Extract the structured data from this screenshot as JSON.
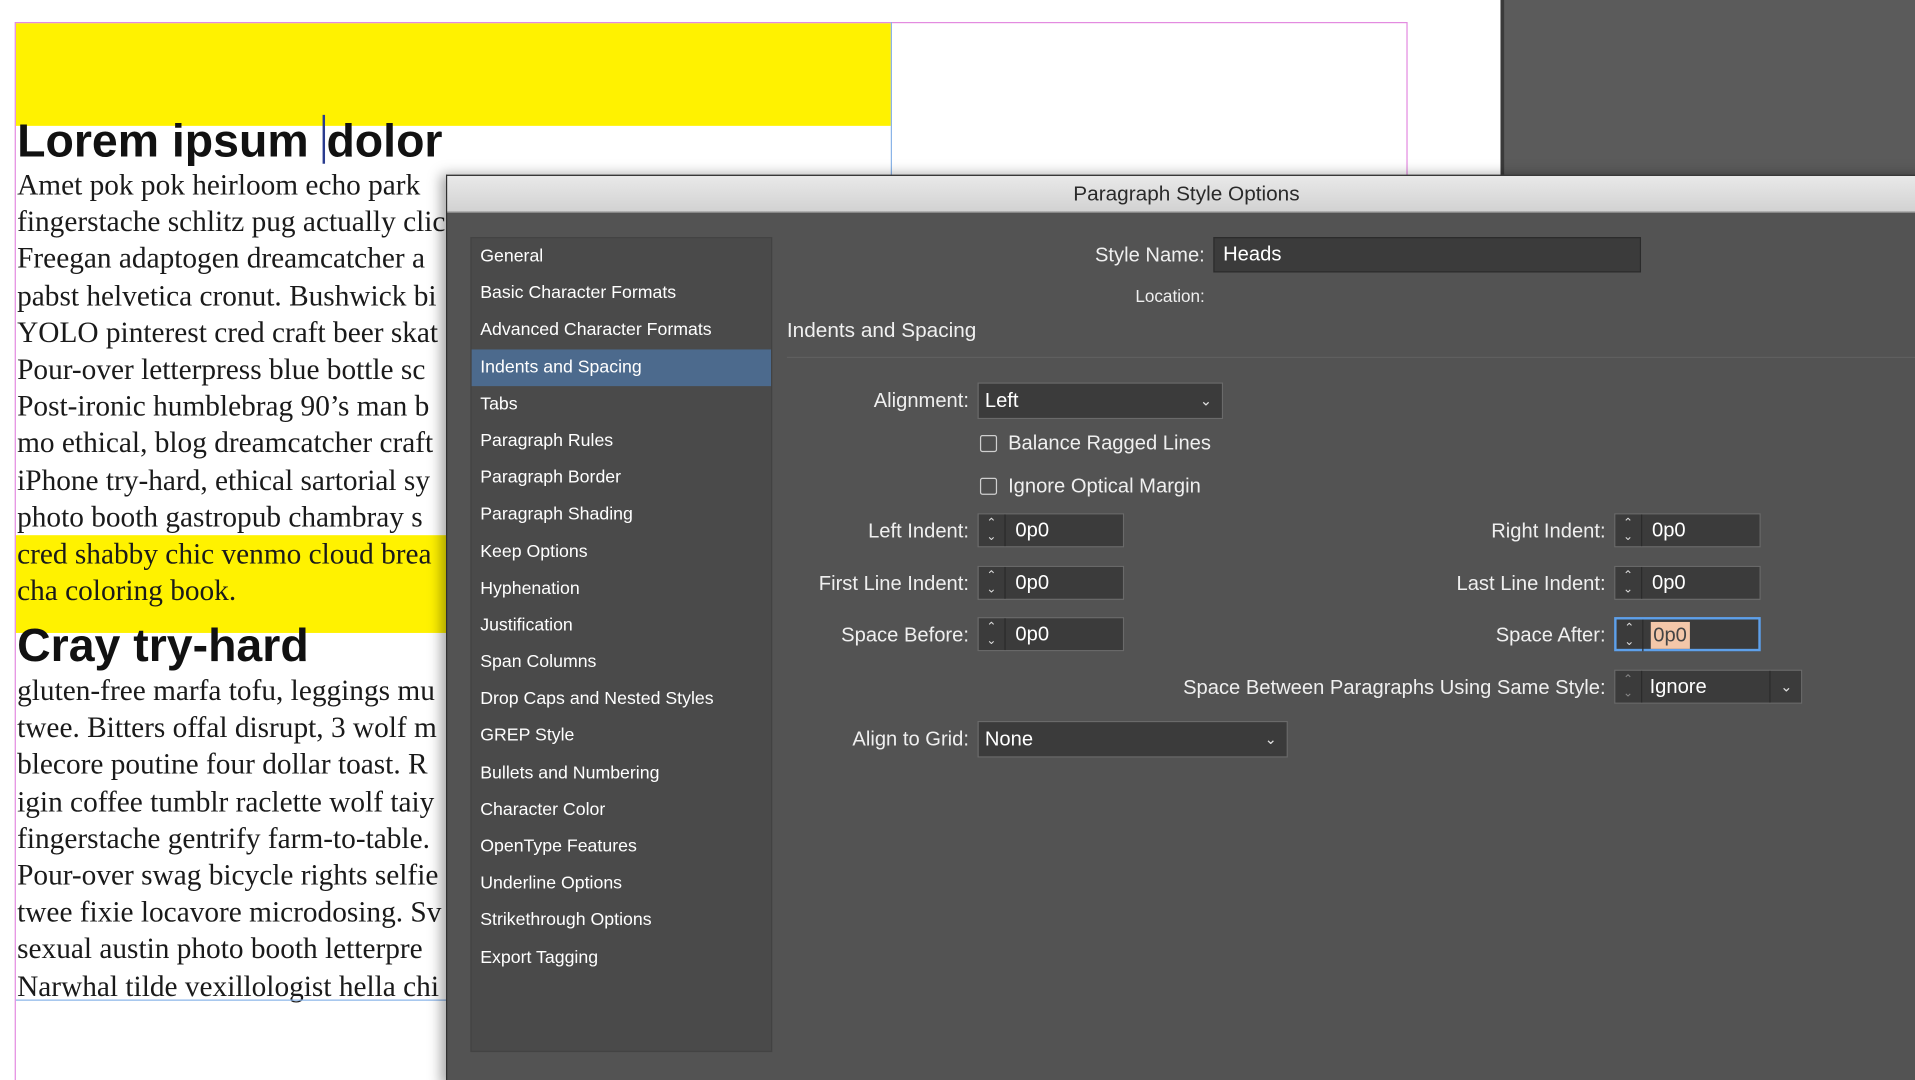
{
  "document": {
    "heading1_before_caret": "Lorem ipsum ",
    "heading1_after_caret": "dolor",
    "body1": [
      "Amet pok pok heirloom echo park",
      "fingerstache schlitz pug actually clic",
      "Freegan adaptogen dreamcatcher a",
      "pabst helvetica cronut. Bushwick bi",
      "YOLO pinterest cred craft beer skat",
      "Pour-over letterpress blue bottle sc",
      "Post-ironic humblebrag 90’s man b",
      "mo ethical, blog dreamcatcher craft",
      "iPhone try-hard, ethical sartorial sy",
      "photo booth gastropub chambray s",
      "cred shabby chic venmo cloud brea",
      "cha coloring book."
    ],
    "heading2": "Cray try-hard",
    "body2": [
      "gluten-free marfa tofu, leggings mu",
      "twee. Bitters offal disrupt, 3 wolf m",
      "blecore poutine four dollar toast. R",
      "igin coffee tumblr raclette wolf taiy",
      "fingerstache gentrify farm-to-table.",
      "Pour-over swag bicycle rights selfie",
      "twee fixie locavore microdosing. Sv",
      "sexual austin photo booth letterpre",
      "Narwhal tilde vexillologist hella chi"
    ]
  },
  "dialog": {
    "title": "Paragraph Style Options",
    "categories": [
      "General",
      "Basic Character Formats",
      "Advanced Character Formats",
      "Indents and Spacing",
      "Tabs",
      "Paragraph Rules",
      "Paragraph Border",
      "Paragraph Shading",
      "Keep Options",
      "Hyphenation",
      "Justification",
      "Span Columns",
      "Drop Caps and Nested Styles",
      "GREP Style",
      "Bullets and Numbering",
      "Character Color",
      "OpenType Features",
      "Underline Options",
      "Strikethrough Options",
      "Export Tagging"
    ],
    "selected_category": "Indents and Spacing",
    "style_name_label": "Style Name:",
    "style_name_value": "Heads",
    "location_label": "Location:",
    "section_title": "Indents and Spacing",
    "alignment_label": "Alignment:",
    "alignment_value": "Left",
    "balance_ragged_label": "Balance Ragged Lines",
    "balance_ragged_checked": false,
    "ignore_optical_label": "Ignore Optical Margin",
    "ignore_optical_checked": false,
    "left_indent_label": "Left Indent:",
    "left_indent_value": "0p0",
    "first_line_indent_label": "First Line Indent:",
    "first_line_indent_value": "0p0",
    "space_before_label": "Space Before:",
    "space_before_value": "0p0",
    "right_indent_label": "Right Indent:",
    "right_indent_value": "0p0",
    "last_line_indent_label": "Last Line Indent:",
    "last_line_indent_value": "0p0",
    "space_after_label": "Space After:",
    "space_after_value": "0p0",
    "space_between_label": "Space Between Paragraphs Using Same Style:",
    "space_between_value": "Ignore",
    "align_grid_label": "Align to Grid:",
    "align_grid_value": "None"
  },
  "colors": {
    "highlight_yellow": "#fff200",
    "dialog_bg": "#535353",
    "selection_blue": "#4c6a8d",
    "focus_ring": "#5ea0ea"
  }
}
